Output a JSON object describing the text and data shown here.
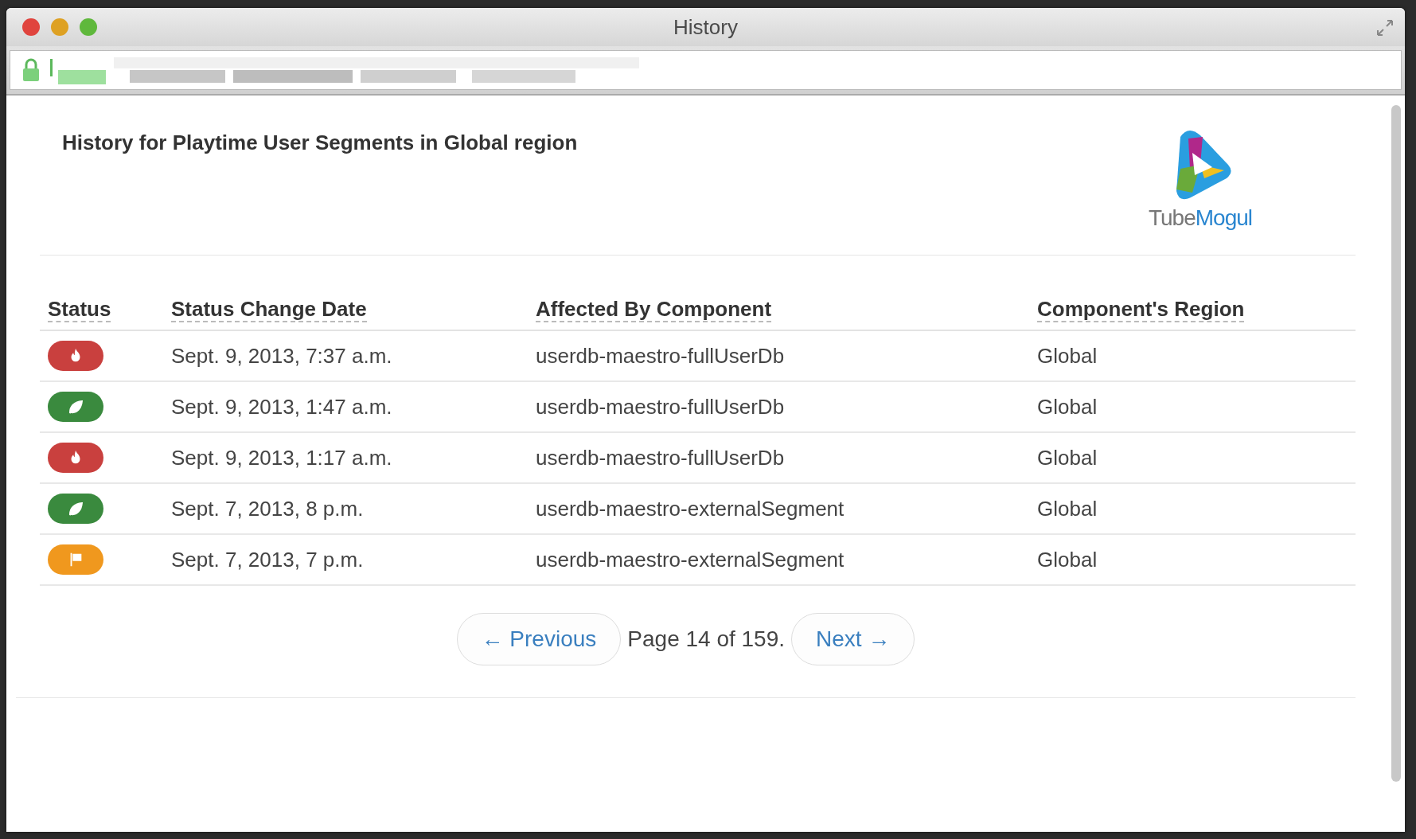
{
  "window": {
    "title": "History"
  },
  "heading": "History for Playtime User Segments in Global region",
  "logo": {
    "part_1": "Tube",
    "part_2": "Mogul"
  },
  "table": {
    "columns": [
      "Status",
      "Status Change Date",
      "Affected By Component",
      "Component's Region"
    ],
    "rows": [
      {
        "status": {
          "kind": "fire",
          "color": "#c9403e"
        },
        "date": "Sept. 9, 2013, 7:37 a.m.",
        "component": "userdb-maestro-fullUserDb",
        "region": "Global"
      },
      {
        "status": {
          "kind": "leaf",
          "color": "#3a8a3e"
        },
        "date": "Sept. 9, 2013, 1:47 a.m.",
        "component": "userdb-maestro-fullUserDb",
        "region": "Global"
      },
      {
        "status": {
          "kind": "fire",
          "color": "#c9403e"
        },
        "date": "Sept. 9, 2013, 1:17 a.m.",
        "component": "userdb-maestro-fullUserDb",
        "region": "Global"
      },
      {
        "status": {
          "kind": "leaf",
          "color": "#3a8a3e"
        },
        "date": "Sept. 7, 2013, 8 p.m.",
        "component": "userdb-maestro-externalSegment",
        "region": "Global"
      },
      {
        "status": {
          "kind": "flag",
          "color": "#f0981e"
        },
        "date": "Sept. 7, 2013, 7 p.m.",
        "component": "userdb-maestro-externalSegment",
        "region": "Global"
      }
    ]
  },
  "pagination": {
    "previous": "← Previous",
    "info": "Page 14 of 159.",
    "next": "Next →"
  }
}
